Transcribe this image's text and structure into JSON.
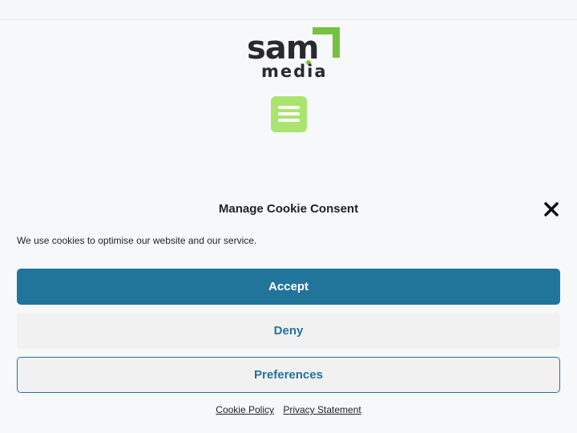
{
  "brand": {
    "word_top": "sam",
    "word_bottom": "media",
    "green": "#76c23f",
    "dark": "#2a2a2e"
  },
  "header": {
    "menu_icon": "hamburger-icon",
    "menu_color": "#a9e56e"
  },
  "consent": {
    "title": "Manage Cookie Consent",
    "close_icon": "close-icon",
    "message": "We use cookies to optimise our website and our service.",
    "accept_label": "Accept",
    "deny_label": "Deny",
    "preferences_label": "Preferences",
    "accent": "#21759b",
    "links": {
      "cookie_policy": "Cookie Policy",
      "privacy_statement": "Privacy Statement"
    }
  }
}
